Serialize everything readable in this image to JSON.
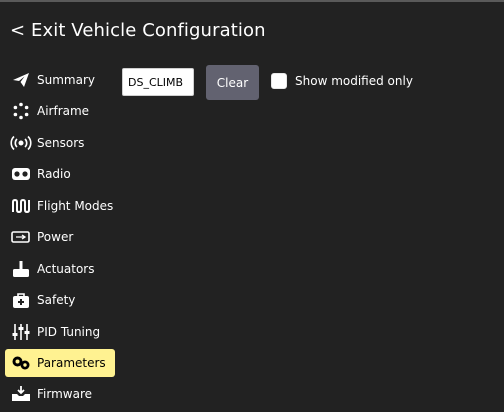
{
  "header": {
    "title": "< Exit Vehicle Configuration"
  },
  "sidebar": {
    "items": [
      {
        "label": "Summary",
        "icon": "paper-plane-icon"
      },
      {
        "label": "Airframe",
        "icon": "airframe-dots-icon"
      },
      {
        "label": "Sensors",
        "icon": "radio-waves-icon"
      },
      {
        "label": "Radio",
        "icon": "radio-controller-icon"
      },
      {
        "label": "Flight Modes",
        "icon": "waveform-icon"
      },
      {
        "label": "Power",
        "icon": "battery-icon"
      },
      {
        "label": "Actuators",
        "icon": "actuator-icon"
      },
      {
        "label": "Safety",
        "icon": "first-aid-icon"
      },
      {
        "label": "PID Tuning",
        "icon": "sliders-icon"
      },
      {
        "label": "Parameters",
        "icon": "gears-icon",
        "active": true
      },
      {
        "label": "Firmware",
        "icon": "firmware-download-icon"
      }
    ]
  },
  "main": {
    "search_value": "DS_CLIMB",
    "clear_label": "Clear",
    "show_modified_label": "Show modified only",
    "show_modified_checked": false
  },
  "colors": {
    "background": "#222222",
    "active_item": "#fff291",
    "clear_button": "#626270",
    "text": "#ffffff"
  }
}
